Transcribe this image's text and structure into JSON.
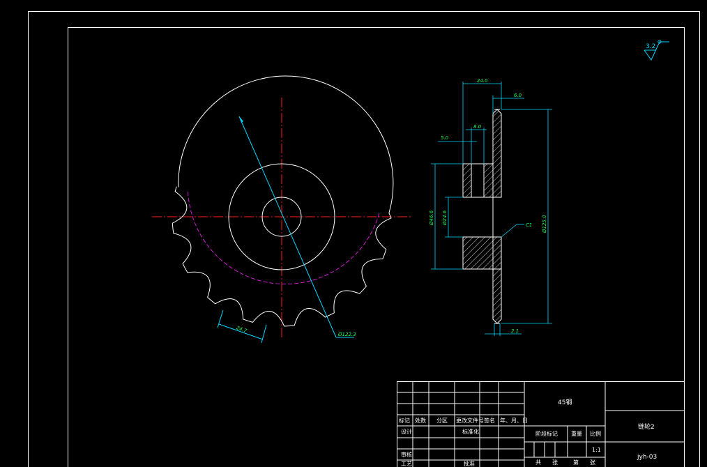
{
  "colors": {
    "background": "#000000",
    "outline": "#ffffff",
    "dimension": "#00d8ff",
    "dimension_text": "#1bff4d",
    "centerline": "#ff1a1a",
    "pitch_circle": "#d21ad2"
  },
  "surface_finish": {
    "value": "3.2"
  },
  "dimensions": {
    "tooth_pitch": "24.7",
    "outer_diameter_front": "Ø122.3",
    "hub_width": "24.0",
    "plate_thickness": "6.0",
    "groove_width": "8.0",
    "step_width": "5.0",
    "hub_diameter": "Ø46.6",
    "bore_diameter": "Ø24.6",
    "chamfer": "C1",
    "outer_diameter_side": "Ø125.0",
    "tip_width": "2.1"
  },
  "title_block": {
    "material": "45钢",
    "part_name": "链轮2",
    "drawing_number": "jyh-03",
    "header_row": [
      "标记",
      "处数",
      "分区",
      "更改文件号",
      "签名",
      "年、月、日"
    ],
    "designer_label": "设计",
    "standardization_label": "标准化",
    "stage_mark_label": "阶段标记",
    "weight_label": "重量",
    "scale_label": "比例",
    "scale_value": "1:1",
    "review_label": "审核",
    "process_label": "工艺",
    "approve_label": "批准",
    "sheet_labels": [
      "共",
      "张",
      "第",
      "张"
    ]
  }
}
